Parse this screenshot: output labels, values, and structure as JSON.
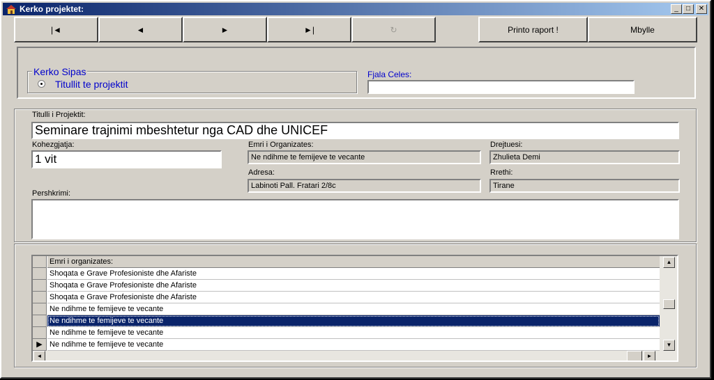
{
  "window": {
    "title": "Kerko projektet:",
    "controls": {
      "minimize": "_",
      "maximize": "□",
      "close": "✕"
    }
  },
  "toolbar": {
    "first": "|◄",
    "prev": "◄",
    "next": "►",
    "last": "►|",
    "refresh": "↻",
    "print": "Printo raport !",
    "close": "Mbylle"
  },
  "search": {
    "group_label": "Kerko Sipas",
    "option_label": "Titullit te projektit",
    "keyword_label": "Fjala Celes:",
    "keyword_value": ""
  },
  "project": {
    "title_label": "Titulli i Projektit:",
    "title_value": "Seminare trajnimi mbeshtetur nga CAD dhe UNICEF",
    "duration_label": "Kohezgjatja:",
    "duration_value": "1 vit",
    "org_label": "Emri i Organizates:",
    "org_value": "Ne ndihme te femijeve te vecante",
    "director_label": "Drejtuesi:",
    "director_value": "Zhulieta Demi",
    "address_label": "Adresa:",
    "address_value": "Labinoti Pall. Fratari 2/8c",
    "district_label": "Rrethi:",
    "district_value": "Tirane",
    "description_label": "Pershkrimi:",
    "description_value": ""
  },
  "grid": {
    "header": "Emri i organizates:",
    "rows": [
      "Shoqata e Grave Profesioniste dhe Afariste",
      "Shoqata e Grave Profesioniste dhe Afariste",
      "Shoqata e Grave Profesioniste dhe Afariste",
      "Ne ndihme te femijeve te vecante",
      "Ne ndihme te femijeve te vecante",
      "Ne ndihme te femijeve te vecante",
      "Ne ndihme te femijeve te vecante"
    ],
    "selected_row": 5,
    "current_row": 7,
    "current_marker": "▶",
    "scroll": {
      "up": "▲",
      "down": "▼",
      "left": "◄",
      "right": "►"
    }
  }
}
